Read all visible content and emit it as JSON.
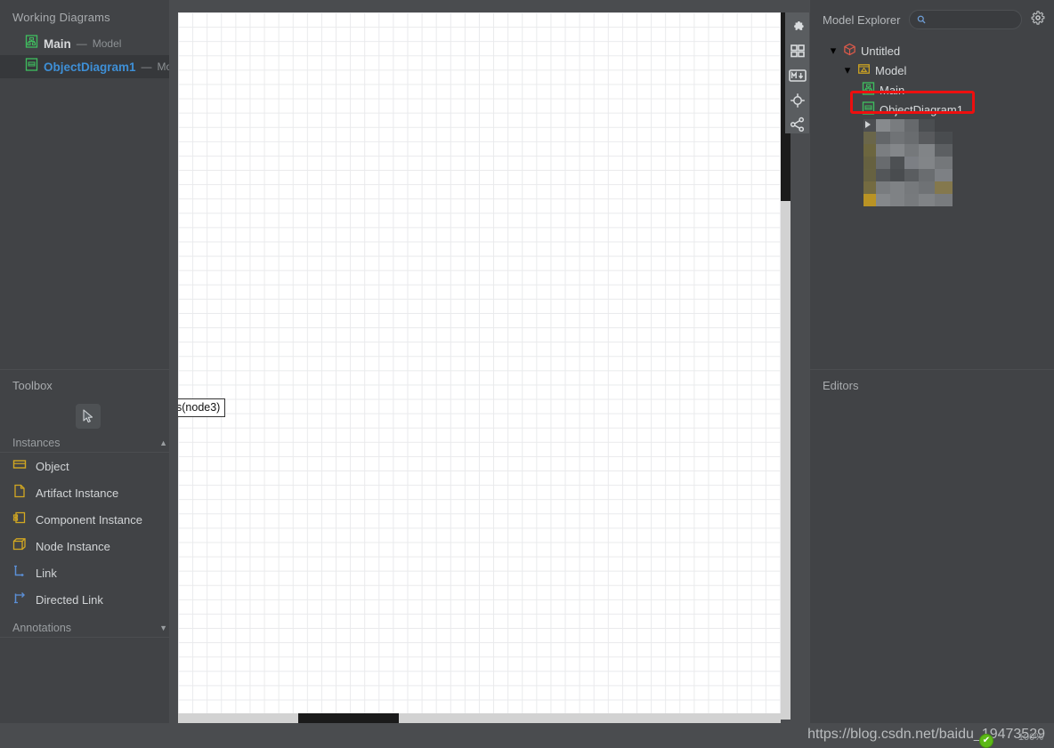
{
  "left_sidebar": {
    "working_diagrams": {
      "title": "Working Diagrams",
      "items": [
        {
          "name": "Main",
          "dash": "—",
          "kind": "Model",
          "icon": "class-diagram-icon",
          "selected": false
        },
        {
          "name": "ObjectDiagram1",
          "dash": "—",
          "kind": "Model",
          "icon": "object-diagram-icon",
          "selected": true
        }
      ]
    },
    "toolbox": {
      "title": "Toolbox",
      "cursor_tool_icon": "arrow-cursor-icon",
      "sections": [
        {
          "label": "Instances",
          "caret": "▲",
          "expanded": true
        },
        {
          "label": "Annotations",
          "caret": "▼",
          "expanded": false
        }
      ],
      "instances": [
        {
          "label": "Object",
          "icon": "object-icon"
        },
        {
          "label": "Artifact Instance",
          "icon": "artifact-icon"
        },
        {
          "label": "Component Instance",
          "icon": "component-icon"
        },
        {
          "label": "Node Instance",
          "icon": "node-icon"
        },
        {
          "label": "Link",
          "icon": "link-icon"
        },
        {
          "label": "Directed Link",
          "icon": "directed-link-icon"
        }
      ]
    }
  },
  "canvas": {
    "node_label": "s(node3)",
    "grid": true,
    "background": "#ffffff",
    "grid_color": "#e9eaec"
  },
  "icon_bar": {
    "items": [
      {
        "name": "puzzle-icon"
      },
      {
        "name": "layout-grid-icon"
      },
      {
        "name": "markdown-icon",
        "label": "M"
      },
      {
        "name": "target-crosshair-icon"
      },
      {
        "name": "share-nodes-icon"
      }
    ]
  },
  "right_panel": {
    "model_explorer": {
      "title": "Model Explorer",
      "search_placeholder": "",
      "search_value": "",
      "search_icon": "search-icon",
      "settings_icon": "gear-icon",
      "tree": [
        {
          "label": "Untitled",
          "icon": "project-cube-icon",
          "depth": 0,
          "twisty": "▾",
          "highlight": false
        },
        {
          "label": "Model",
          "icon": "package-icon",
          "depth": 1,
          "twisty": "▾",
          "highlight": false
        },
        {
          "label": "Main",
          "icon": "class-diagram-icon",
          "depth": 2,
          "twisty": "",
          "highlight": false
        },
        {
          "label": "ObjectDiagram1",
          "icon": "object-diagram-icon",
          "depth": 2,
          "twisty": "",
          "highlight": true
        }
      ],
      "highlight_color": "#ee0f0f",
      "redacted_region": true
    },
    "editors": {
      "title": "Editors"
    }
  },
  "status_bar": {
    "watermark": "https://blog.csdn.net/baidu_19473529",
    "zoom_level": "100%",
    "check_icon": "check-circle-icon",
    "check_glyph": "✔"
  }
}
